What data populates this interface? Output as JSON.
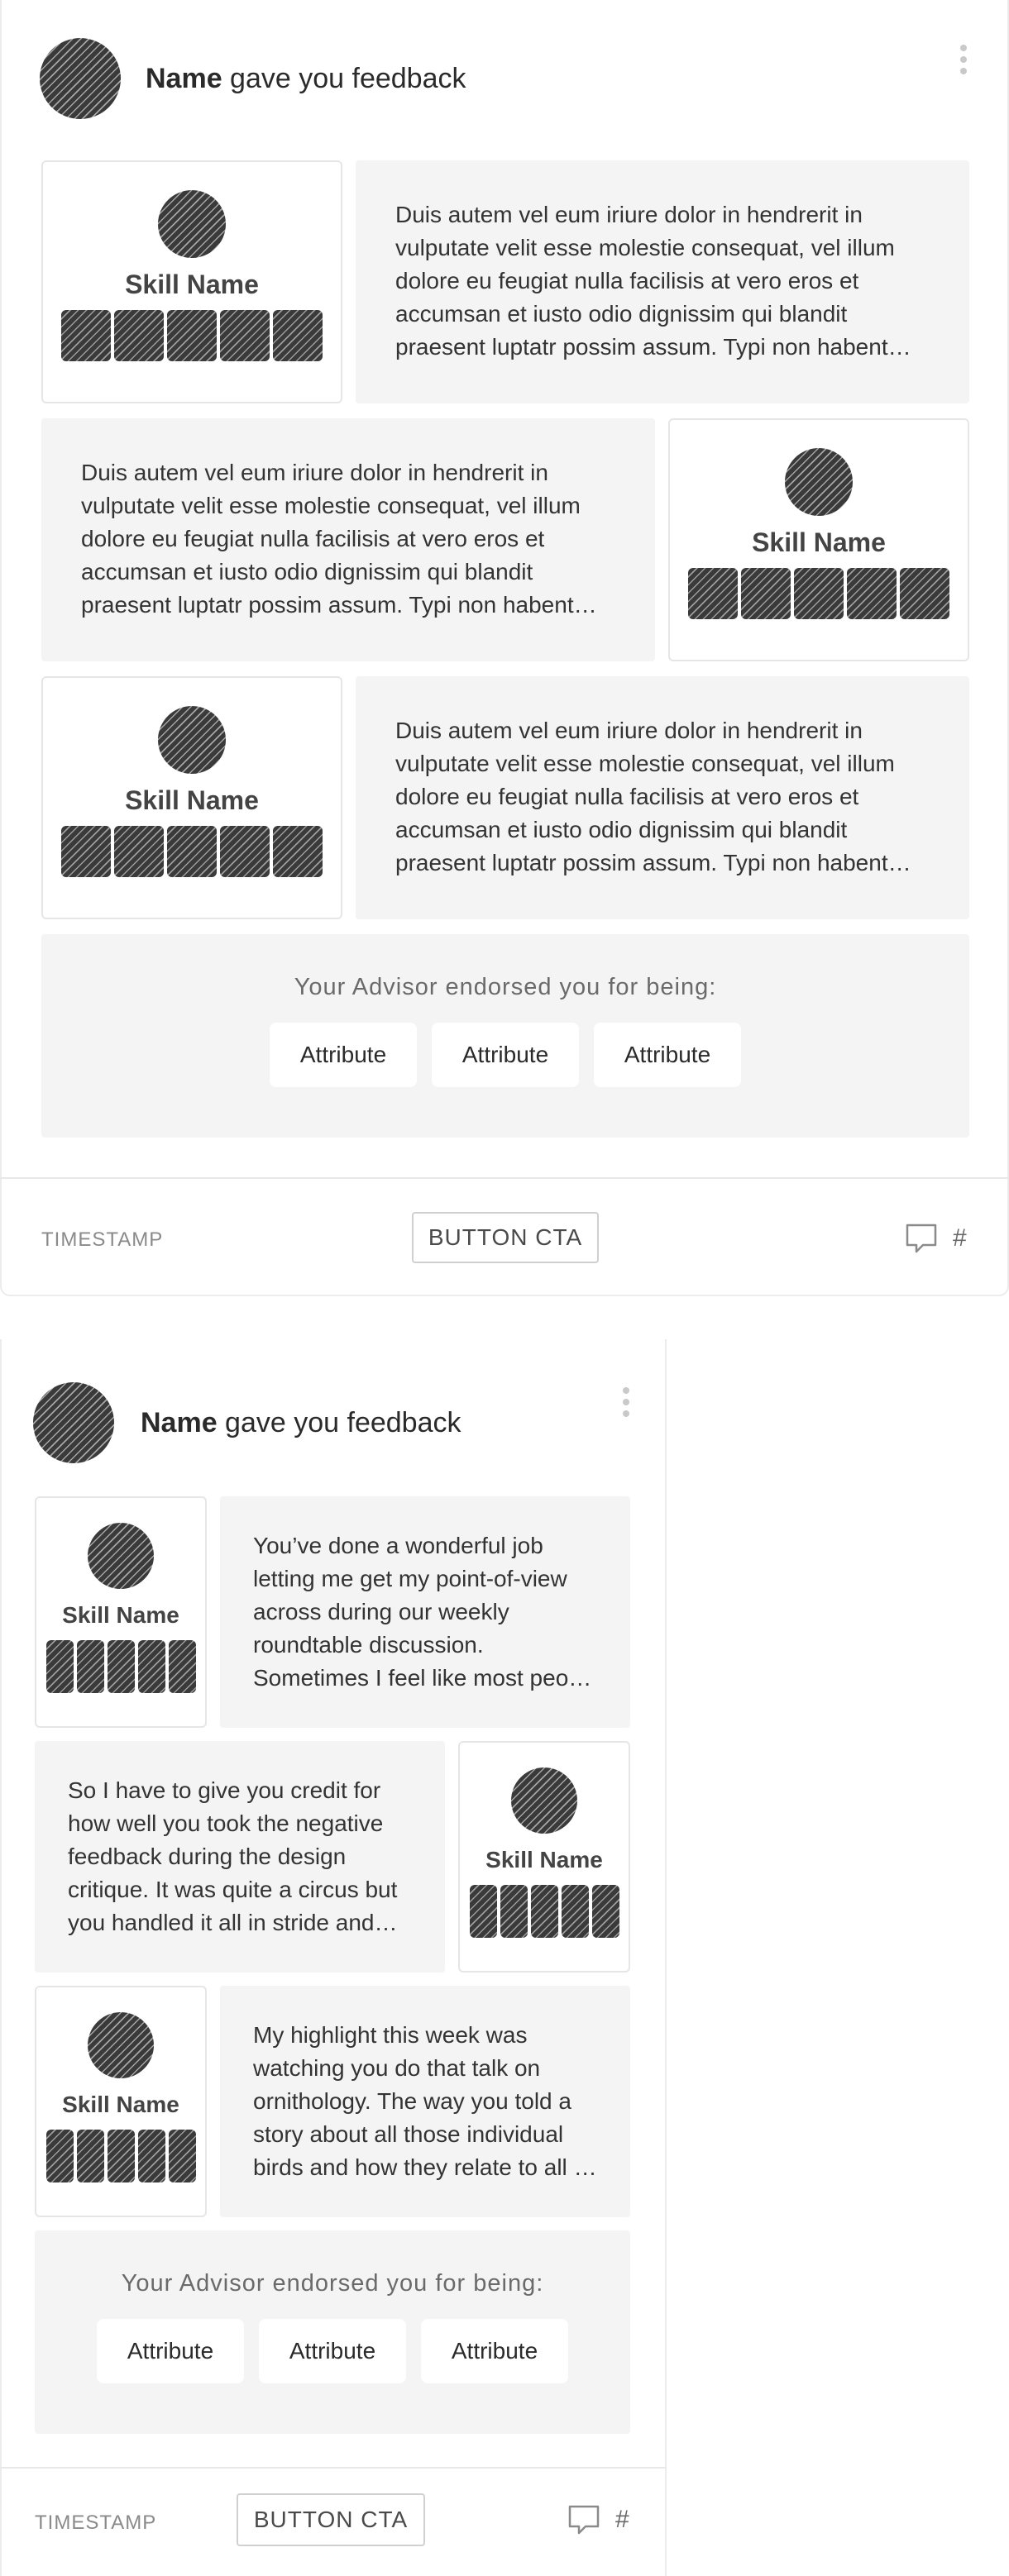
{
  "cards": [
    {
      "author": "Name",
      "action": " gave you feedback",
      "skill_name": "Skill Name",
      "feedback": [
        "Duis autem vel eum iriure dolor in hendrerit in vulputate velit esse molestie consequat, vel illum dolore eu feugiat nulla facilisis at vero eros et accumsan et iusto odio dignissim qui blandit praesent luptatr possim assum. Typi non habent claritatem insitam.",
        "Duis autem vel eum iriure dolor in hendrerit in vulputate velit esse molestie consequat, vel illum dolore eu feugiat nulla facilisis at vero eros et accumsan et iusto odio dignissim qui blandit praesent luptatr possim assum. Typi non habent claritatem insitam.",
        "Duis autem vel eum iriure dolor in hendrerit in vulputate velit esse molestie consequat, vel illum dolore eu feugiat nulla facilisis at vero eros et accumsan et iusto odio dignissim qui blandit praesent luptatr possim assum. Typi non habent claritatem insitam."
      ],
      "rating": 5,
      "endorse_title": "Your Advisor endorsed you for being:",
      "attributes": [
        "Attribute",
        "Attribute",
        "Attribute"
      ],
      "timestamp": "TIMESTAMP",
      "cta_label": "BUTTON CTA",
      "comment_count": "#"
    },
    {
      "author": "Name",
      "action": " gave you feedback",
      "skill_name": "Skill Name",
      "feedback": [
        "You’ve done a wonderful job letting me get my point-of-view across during our weekly roundtable discussion. Sometimes I feel like most people don’t listen.",
        "So I have to give you credit for how well you took the negative feedback during the design critique. It was quite a circus but you handled it all in stride and kept calm.",
        "My highlight this week was watching you do that talk on ornithology. The way you told a story about all those individual birds and how they relate to all of us."
      ],
      "rating": 5,
      "endorse_title": "Your Advisor endorsed you for being:",
      "attributes": [
        "Attribute",
        "Attribute",
        "Attribute"
      ],
      "timestamp": "TIMESTAMP",
      "cta_label": "BUTTON CTA",
      "comment_count": "#"
    }
  ]
}
